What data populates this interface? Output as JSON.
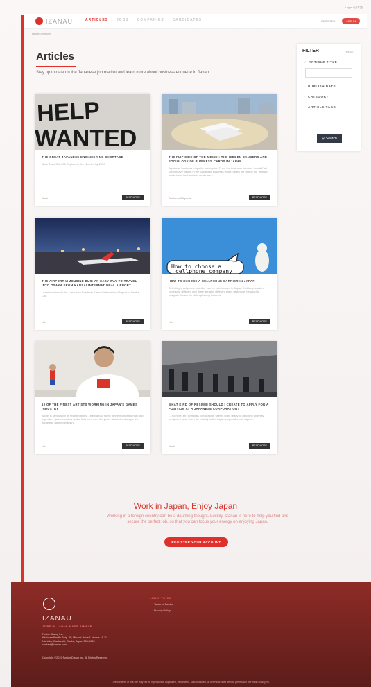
{
  "top": {
    "link": "Login • 日本語"
  },
  "header": {
    "brand": "IZANAU",
    "nav": [
      "ARTICLES",
      "JOBS",
      "COMPANIES",
      "CANDIDATES"
    ],
    "signup": "REGISTER",
    "login": "LOG IN"
  },
  "breadcrumb": "Home > Articles",
  "page": {
    "title": "Articles",
    "subtitle": "Stay up to date on the Japanese job market and learn more about business etiquette in Japan."
  },
  "cards": [
    {
      "title": "The Great Japanese Engineering Shortage",
      "excerpt": "More Than 300,000 Engineers Are Needed by 2030",
      "tag": "Work",
      "read": "READ MORE",
      "img": "help-wanted"
    },
    {
      "title": "The Flip Side of the Meishi: The Hidden Dangers and Sociology of Business Cards in Japan",
      "excerpt": "Japanese business etiquette is complex. From the business cards or \"meishi\" all carry heavy weight in the Japanese business world. Learn the role of the \"meishi\" to increase the business cards are...",
      "tag": "Business Etiquette",
      "read": "READ MORE",
      "img": "meishi"
    },
    {
      "title": "The Airport Limousine Bus: An Easy Way to Travel into Osaka from Kansai International Airport",
      "excerpt": "Learn how to ride the Limousine Bus from Kansai International Airport to Osaka City.",
      "tag": "Life",
      "read": "READ MORE",
      "img": "airport"
    },
    {
      "title": "How to Choose a Cellphone Carrier in Japan",
      "excerpt": "Selecting a cellphone provider can be complicated in Japan. Hidden prevalent contracts, different and there are also different plans which can be used to navigate. Learn the distinguishing features.",
      "tag": "Life",
      "read": "READ MORE",
      "img": "cellphone"
    },
    {
      "title": "10 of the Finest Artists Working in Japan's Games Industry",
      "excerpt": "Japan is famous for its stylish games. Learn about some of the most influential and legendary game creators and artists from over the years who helped shape the Japanese gaming industry.",
      "tag": "Life",
      "read": "READ MORE",
      "img": "artist"
    },
    {
      "title": "What Kind of Resume Should I Create to Apply for a Position at a Japanese Corporation?",
      "excerpt": "... So here, an \"overseas corporation\" seems to be ready to welcome diversity, foreigners have been the priority to the Japan corporations in Japan ...",
      "tag": "Work",
      "read": "READ MORE",
      "img": "resume"
    }
  ],
  "filter": {
    "title": "FILTER",
    "reset": "RESET",
    "items": [
      "ARTICLE TITLE",
      "PUBLISH DATE",
      "CATEGORY",
      "ARTICLE TAGS"
    ],
    "button": "Search"
  },
  "cta": {
    "title": "Work in Japan, Enjoy Japan",
    "text": "Working in a foreign country can be a daunting thought. Luckily, Izanau is here to help you find and secure the perfect job, so that you can focus your energy on enjoying Japan.",
    "button": "REGISTER YOUR ACCOUNT"
  },
  "footer": {
    "brand": "IZANAU",
    "tagline": "JOBS IN JAPAN MADE SIMPLE",
    "address": [
      "Fusion Dialog Inc.",
      "Kitahorie Pacific Bldg. 6F, Minami-Horie 1-chome 15-11,",
      "Nishi-ku, Osaka-shi, Osaka, Japan 550-0015",
      "contact@izanau.com"
    ],
    "copyright": "Copyright ©2019 Fusion Dialog Inc. All Rights Reserved.",
    "col_head": "LINKS TO GO",
    "col_links": [
      "Terms of Service",
      "Privacy Policy"
    ],
    "bottom": "The contents of this site may not be reproduced, duplicated, transmitted, sold, modified, or otherwise used without permission of Fusion Dialog Inc."
  }
}
